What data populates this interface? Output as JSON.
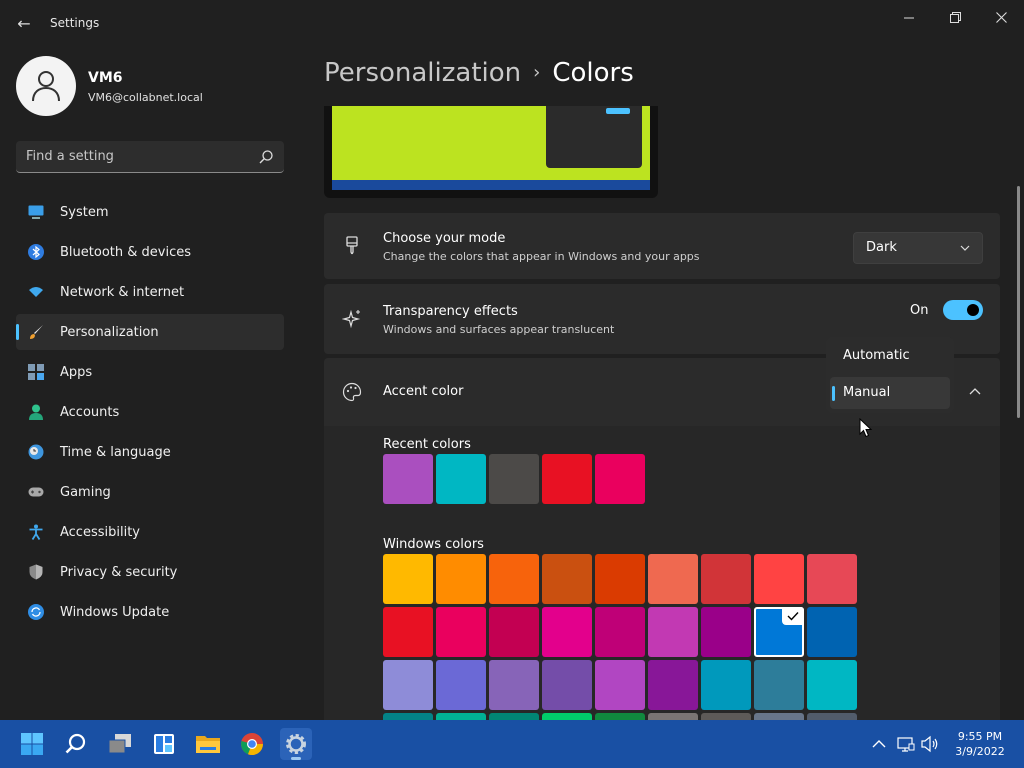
{
  "window": {
    "title": "Settings",
    "back": "←"
  },
  "profile": {
    "name": "VM6",
    "email": "VM6@collabnet.local"
  },
  "search": {
    "placeholder": "Find a setting"
  },
  "sidebar": {
    "items": [
      {
        "label": "System",
        "icon": "monitor-icon"
      },
      {
        "label": "Bluetooth & devices",
        "icon": "bluetooth-icon"
      },
      {
        "label": "Network & internet",
        "icon": "wifi-icon"
      },
      {
        "label": "Personalization",
        "icon": "brush-icon",
        "active": true
      },
      {
        "label": "Apps",
        "icon": "apps-icon"
      },
      {
        "label": "Accounts",
        "icon": "person-icon"
      },
      {
        "label": "Time & language",
        "icon": "clock-globe-icon"
      },
      {
        "label": "Gaming",
        "icon": "gamepad-icon"
      },
      {
        "label": "Accessibility",
        "icon": "accessibility-icon"
      },
      {
        "label": "Privacy & security",
        "icon": "shield-icon"
      },
      {
        "label": "Windows Update",
        "icon": "sync-icon"
      }
    ]
  },
  "breadcrumb": {
    "parent": "Personalization",
    "separator": "›",
    "current": "Colors"
  },
  "mode": {
    "title": "Choose your mode",
    "description": "Change the colors that appear in Windows and your apps",
    "value": "Dark"
  },
  "transparency": {
    "title": "Transparency effects",
    "description": "Windows and surfaces appear translucent",
    "state_label": "On",
    "enabled": true
  },
  "accent": {
    "title": "Accent color",
    "dropdown_options": [
      "Automatic",
      "Manual"
    ],
    "selected_option": "Manual",
    "recent_label": "Recent colors",
    "recent_colors": [
      "#aa4fbf",
      "#00b7c3",
      "#4c4a48",
      "#e81123",
      "#ea005e"
    ],
    "windows_label": "Windows colors",
    "windows_colors": [
      [
        "#ffb900",
        "#ff8c00",
        "#f7630c",
        "#ca5010",
        "#da3b01",
        "#ef6950",
        "#d13438",
        "#ff4343",
        "#e74856"
      ],
      [
        "#e81123",
        "#ea005e",
        "#c30052",
        "#e3008c",
        "#bf0077",
        "#c239b3",
        "#9a0089",
        "#0078d7",
        "#0063b1"
      ],
      [
        "#8e8cd8",
        "#6b69d6",
        "#8764b8",
        "#744da9",
        "#b146c2",
        "#881798",
        "#0099bc",
        "#2d7d9a",
        "#00b7c3"
      ],
      [
        "#038387",
        "#00b294",
        "#018574",
        "#00cc6a",
        "#10893e",
        "#7a7574",
        "#5d5a58",
        "#68768a",
        "#515c6b"
      ]
    ],
    "selected_color": "#0078d7"
  },
  "taskbar": {
    "apps": [
      "start-icon",
      "search-icon",
      "task-view-icon",
      "widgets-icon",
      "file-explorer-icon",
      "chrome-icon",
      "settings-icon"
    ],
    "active_app": "settings-icon",
    "time": "9:55 PM",
    "date": "3/9/2022"
  },
  "colors": {
    "accent": "#4cc2ff",
    "taskbar": "#1950a4",
    "background": "#202020",
    "card": "#2b2b2b"
  }
}
